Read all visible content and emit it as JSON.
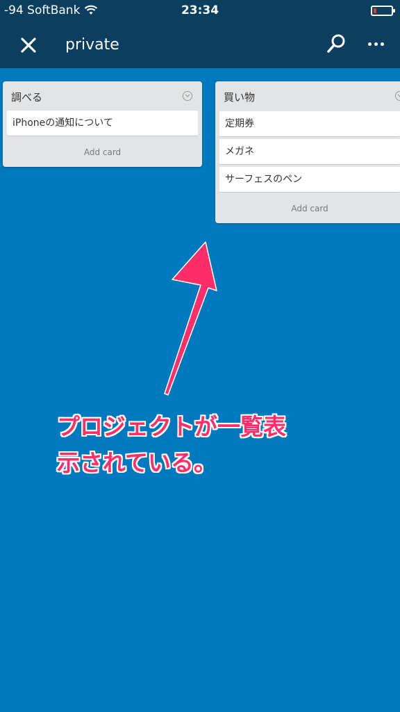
{
  "status_bar": {
    "carrier": "-94 SoftBank",
    "time": "23:34"
  },
  "header": {
    "title": "private"
  },
  "lists": [
    {
      "name": "調べる",
      "cards": [
        "iPhoneの通知について"
      ],
      "add_label": "Add card"
    },
    {
      "name": "買い物",
      "cards": [
        "定期券",
        "メガネ",
        "サーフェスのペン"
      ],
      "add_label": "Add card"
    }
  ],
  "annotation": {
    "line1": "プロジェクトが一覧表",
    "line2": "示されている。"
  },
  "colors": {
    "board_background": "#0079bf",
    "header_background": "#0c3f5f",
    "annotation": "#ff2c6a",
    "battery": "#e0402f"
  }
}
